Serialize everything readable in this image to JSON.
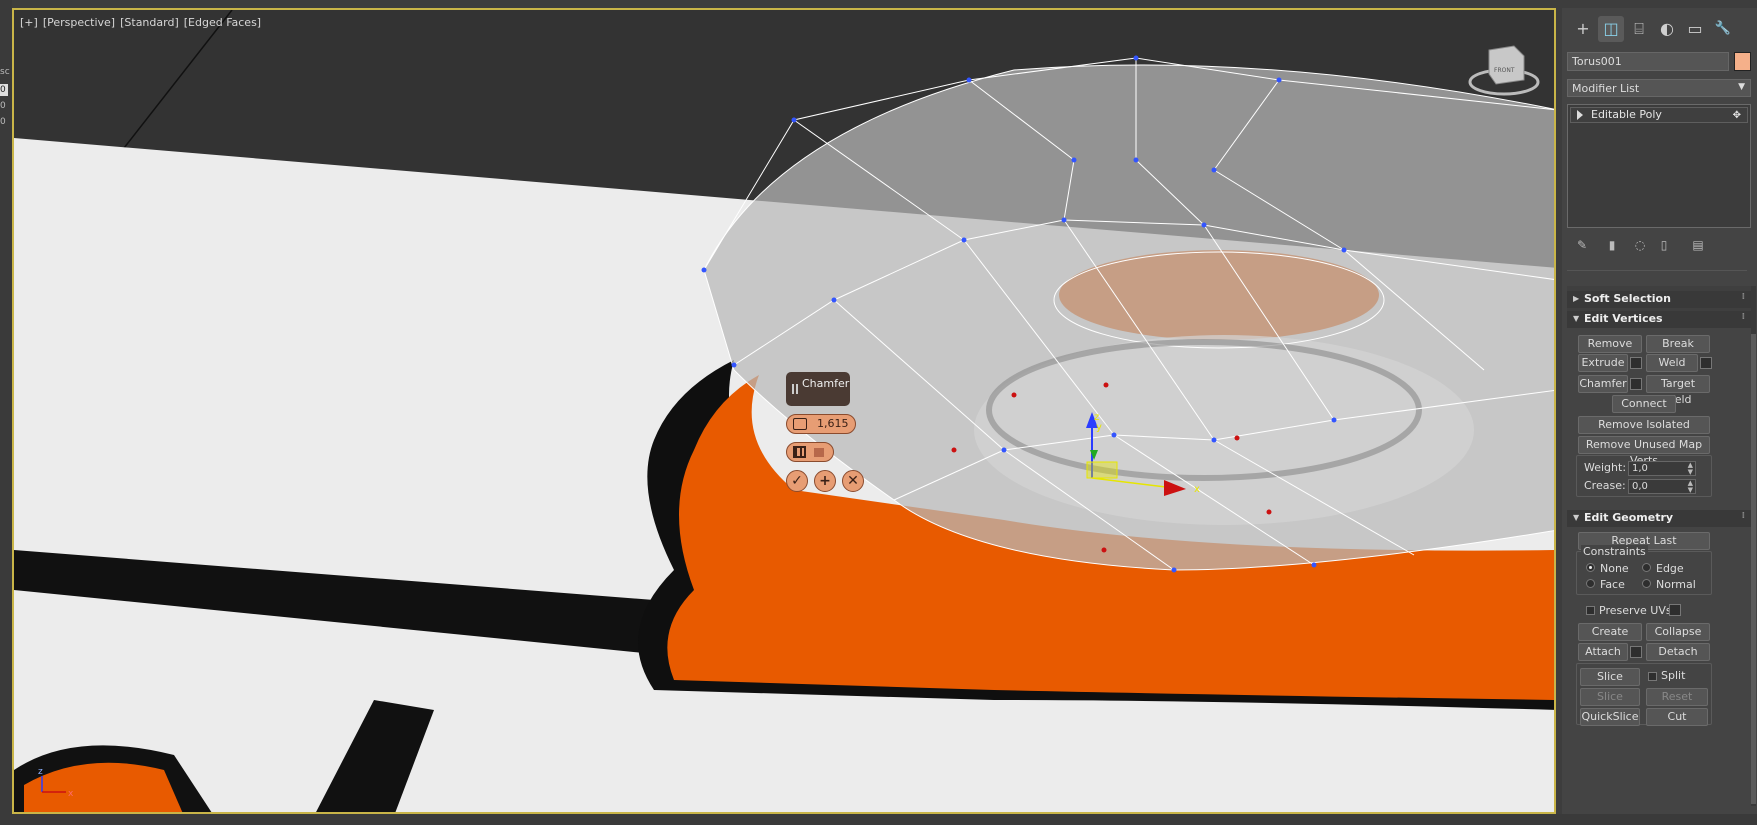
{
  "viewport": {
    "label_plus": "[+]",
    "label_view": "[Perspective]",
    "label_shading": "[Standard]",
    "label_faces": "[Edged Faces]",
    "viewcube_label": "FRONT",
    "gizmo_x": "x",
    "gizmo_y": "y",
    "gizmo_z": "z",
    "axis_x": "x",
    "axis_z": "z"
  },
  "left_strip": {
    "t1": "sc",
    "t2": "0",
    "t3": "0",
    "t4": "0"
  },
  "caddy": {
    "title": "Chamfer",
    "amount": "1,615",
    "ok_icon": "check-icon",
    "apply_icon": "plus-icon",
    "cancel_icon": "x-icon"
  },
  "panel": {
    "tabs": [
      "+",
      "◫",
      "⌸",
      "◐",
      "▭",
      "🔧"
    ],
    "object_name": "Torus001",
    "object_color": "#f5b08a",
    "modifier_list": "Modifier List",
    "stack_item": "Editable Poly",
    "soft_selection": "Soft Selection",
    "edit_vertices": "Edit Vertices",
    "remove": "Remove",
    "break": "Break",
    "extrude": "Extrude",
    "weld": "Weld",
    "chamfer": "Chamfer",
    "target_weld": "Target Weld",
    "connect": "Connect",
    "remove_isolated": "Remove Isolated Vertices",
    "remove_unused": "Remove Unused Map Verts",
    "weight_label": "Weight:",
    "weight_value": "1,0",
    "crease_label": "Crease:",
    "crease_value": "0,0",
    "edit_geometry": "Edit Geometry",
    "repeat_last": "Repeat Last",
    "constraints": "Constraints",
    "none": "None",
    "edge": "Edge",
    "face": "Face",
    "normal": "Normal",
    "preserve_uvs": "Preserve UVs",
    "create": "Create",
    "collapse": "Collapse",
    "attach": "Attach",
    "detach": "Detach",
    "slice_plane": "Slice Plane",
    "split": "Split",
    "slice": "Slice",
    "reset_plane": "Reset Plane",
    "quickslice": "QuickSlice",
    "cut": "Cut"
  },
  "colors": {
    "viewport_border": "#c9b548",
    "orange": "#e85a00",
    "accent": "#8ad0e8"
  }
}
